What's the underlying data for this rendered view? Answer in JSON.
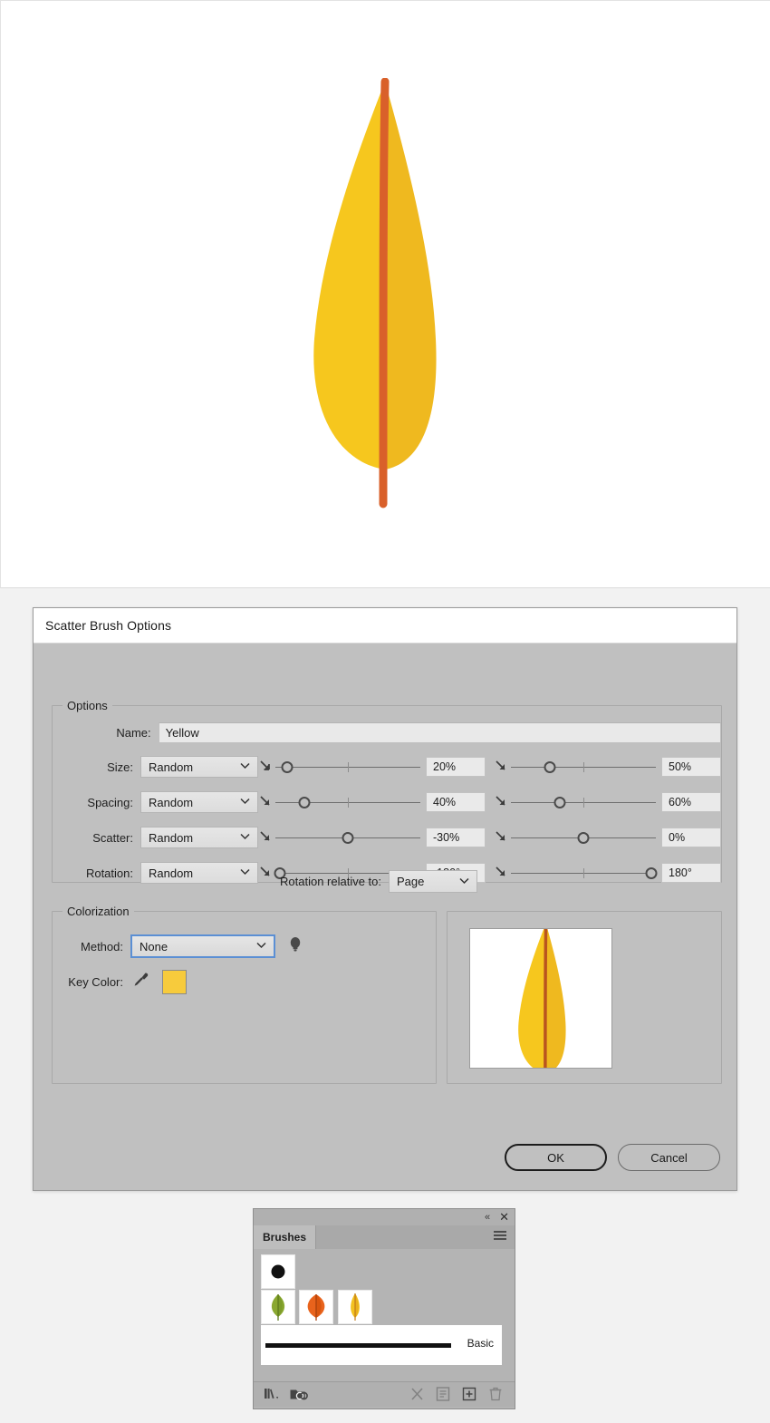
{
  "canvas": {
    "artwork_name": "yellow-leaf-artwork",
    "leaf_light": "#f5c41f",
    "leaf_dark": "#efb721",
    "leaf_stem": "#d9602a"
  },
  "dialog": {
    "title": "Scatter Brush Options",
    "options_group_legend": "Options",
    "name_label": "Name:",
    "name_value": "Yellow",
    "rows": [
      {
        "key": "size",
        "label": "Size:",
        "mode": "Random",
        "min_value": "20%",
        "max_value": "50%",
        "min_pos": 8,
        "max_pos": 27,
        "min_tick": 50,
        "max_tick": 50
      },
      {
        "key": "spacing",
        "label": "Spacing:",
        "mode": "Random",
        "min_value": "40%",
        "max_value": "60%",
        "min_pos": 20,
        "max_pos": 34,
        "min_tick": 50,
        "max_tick": 50
      },
      {
        "key": "scatter",
        "label": "Scatter:",
        "mode": "Random",
        "min_value": "-30%",
        "max_value": "0%",
        "min_pos": 50,
        "max_pos": 50,
        "min_tick": -1,
        "max_tick": -1
      },
      {
        "key": "rotation",
        "label": "Rotation:",
        "mode": "Random",
        "min_value": "-180°",
        "max_value": "180°",
        "min_pos": 3,
        "max_pos": 97,
        "min_tick": 50,
        "max_tick": 50
      }
    ],
    "rotation_relative_label": "Rotation relative to:",
    "rotation_relative_value": "Page",
    "colorization_group_legend": "Colorization",
    "method_label": "Method:",
    "method_value": "None",
    "key_color_label": "Key Color:",
    "key_color_value": "#f7cb3c",
    "ok_label": "OK",
    "cancel_label": "Cancel"
  },
  "brushes_panel": {
    "tab_label": "Brushes",
    "stroke_label": "Basic",
    "thumbnails_row1": [
      "black-dot-brush"
    ],
    "thumbnails_row2": [
      "green-leaf-brush",
      "orange-leaf-brush",
      "yellow-leaf-brush"
    ],
    "footer_icons": [
      "brush-libraries-menu-icon",
      "libraries-panel-icon",
      "remove-brush-stroke-icon",
      "brush-options-icon",
      "new-brush-icon",
      "delete-brush-icon"
    ],
    "collapse_glyph": "«",
    "close_glyph": "✕"
  }
}
